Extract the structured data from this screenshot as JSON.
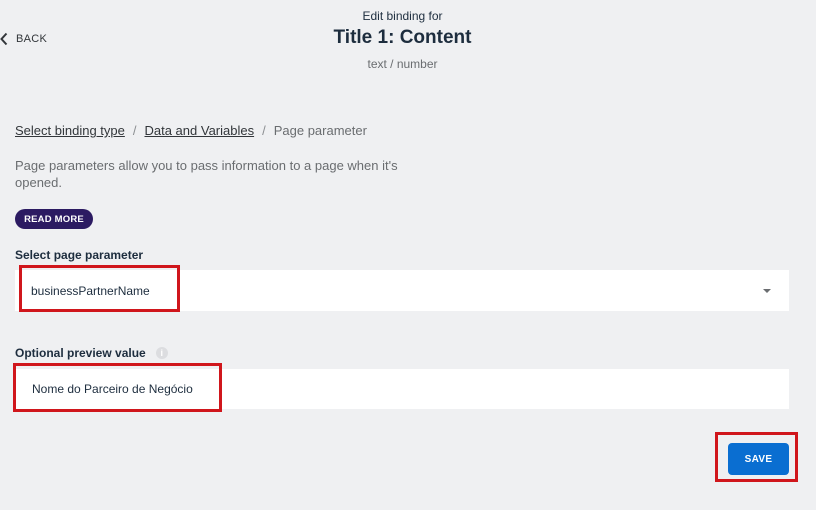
{
  "header": {
    "back_label": "BACK",
    "pre_title": "Edit binding for",
    "title": "Title 1: Content",
    "subtitle": "text / number"
  },
  "breadcrumb": {
    "items": [
      {
        "label": "Select binding type",
        "link": true
      },
      {
        "label": "Data and Variables",
        "link": true
      },
      {
        "label": "Page parameter",
        "link": false
      }
    ],
    "separator": "/"
  },
  "description": "Page parameters allow you to pass information to a page when it's opened.",
  "read_more_label": "READ MORE",
  "page_parameter": {
    "label": "Select page parameter",
    "selected_value": "businessPartnerName"
  },
  "preview": {
    "label": "Optional preview value",
    "info_icon": "i",
    "value": "Nome do Parceiro de Negócio"
  },
  "save_label": "SAVE",
  "colors": {
    "background": "#eff0f2",
    "read_more_bg": "#2c1b62",
    "save_bg": "#0a6ed1",
    "highlight": "#d0161c"
  }
}
